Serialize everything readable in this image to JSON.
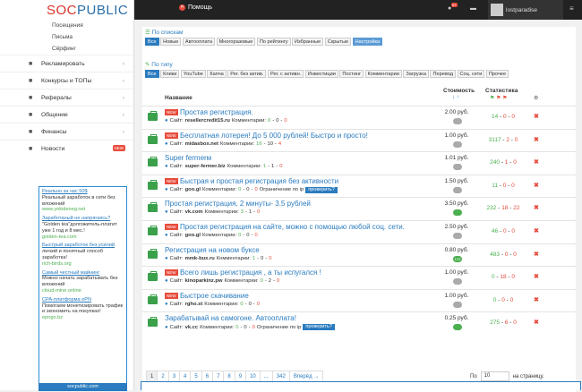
{
  "topbar": {
    "logo_a": "SOC",
    "logo_b": "PUBLIC",
    "help": "Помощь",
    "badge": "9+",
    "user": "lostparadise"
  },
  "sidebar": {
    "subitems": [
      "Посещения",
      "Письма",
      "Сёрфинг"
    ],
    "items": [
      {
        "label": "Рекламировать",
        "icon": "chart-icon"
      },
      {
        "label": "Конкурсы и ТОПы",
        "icon": "trophy-icon"
      },
      {
        "label": "Рефералы",
        "icon": "users-icon"
      },
      {
        "label": "Общение",
        "icon": "chat-icon"
      },
      {
        "label": "Финансы",
        "icon": "bank-icon"
      },
      {
        "label": "Новости",
        "icon": "news-icon",
        "badge": "NEW"
      }
    ],
    "ads": [
      {
        "title": "Реально за час 50$",
        "desc": "Реальный заработок в сети без вложений",
        "url": "www.yokideneg.net"
      },
      {
        "title": "Заработаный не напрягаясь?",
        "desc": "\"Golden tea\"долгожитель-платит уже 1 год и 8 мес.!",
        "url": "golden-tea.com"
      },
      {
        "title": "Быстрый заработок без усилий",
        "desc": "легкий и понятный способ заработка!",
        "url": "rich-birds.org"
      },
      {
        "title": "Самый честный майнинг",
        "desc": "Можно начать зарабатывать без вложений",
        "url": "cloud-mine.online"
      },
      {
        "title": "CPA-платформа ePN",
        "desc": "Помогаем монетизировать трафик и экономить на покупках!",
        "url": "epngo.bz"
      }
    ],
    "ads_footer": "socpublic.com"
  },
  "lists": {
    "title": "По спискам",
    "filters": [
      "Все",
      "Новые",
      "Автооплата",
      "Многоразовые",
      "По рейтингу",
      "Избранные",
      "Скрытые",
      "Настройка"
    ]
  },
  "types": {
    "title": "По типу",
    "filters": [
      "Все",
      "Клики",
      "YouTube",
      "Капча",
      "Рег. без актив.",
      "Рег. с активн.",
      "Инвестиции",
      "Постинг",
      "Комментарии",
      "Загрузка",
      "Перевод",
      "Соц. сети",
      "Прочее"
    ]
  },
  "table": {
    "h_name": "Название",
    "h_cost": "Стоимость",
    "h_stats": "Статистика",
    "site_label": "Сайт:",
    "comments_label": "Комментарии:",
    "limit_label": "Ограничение по ip",
    "check_label": "проверить?",
    "rows": [
      {
        "new": true,
        "title": "Простая регистрация.",
        "site": "resellercredit15.ru",
        "c": [
          "0",
          "0",
          "0"
        ],
        "cost": "2.00 руб.",
        "pill": "",
        "pillc": "#aaa",
        "st": [
          "14",
          "0",
          "0"
        ]
      },
      {
        "new": true,
        "title": "Бесплатная лотерея! До 5 000 рублей! Быстро и просто!",
        "site": "midasbox.net",
        "c": [
          "16",
          "10",
          "4"
        ],
        "cost": "1.00 руб.",
        "pill": "",
        "pillc": "#aaa",
        "st": [
          "3117",
          "2",
          "0"
        ]
      },
      {
        "new": false,
        "title": "Super fermerм",
        "site": "super-fermer.biz",
        "c": [
          "1",
          "1",
          "0"
        ],
        "cost": "1.01 руб.",
        "pill": "",
        "pillc": "#aaa",
        "st": [
          "240",
          "1",
          "0"
        ]
      },
      {
        "new": true,
        "title": "Быстрая и простая регистрация без активности",
        "site": "goo.gl",
        "c": [
          "0",
          "0",
          "0"
        ],
        "limit": true,
        "cost": "1.50 руб.",
        "pill": "",
        "pillc": "#aaa",
        "st": [
          "11",
          "0",
          "0"
        ]
      },
      {
        "new": false,
        "title": "Простая регистрация, 2 минуты- 3.5 рублей",
        "site": "vk.com",
        "c": [
          "3",
          "1",
          "0"
        ],
        "cost": "3.50 руб.",
        "pill": "",
        "pillc": "#4caf50",
        "st": [
          "232",
          "18",
          "22"
        ]
      },
      {
        "new": true,
        "title": "Простая регистрация на сайте, можно с помощью любой соц. сети.",
        "site": "goo.gl",
        "c": [
          "0",
          "0",
          "0"
        ],
        "cost": "2.50 руб.",
        "pill": "",
        "pillc": "#aaa",
        "st": [
          "46",
          "0",
          "0"
        ]
      },
      {
        "new": false,
        "title": "Регистрация на новом буксе",
        "site": "mmk-bux.ru",
        "c": [
          "1",
          "0",
          "0"
        ],
        "cost": "0.80 руб.",
        "pill": "123",
        "pillc": "#4caf50",
        "st": [
          "483",
          "0",
          "0"
        ]
      },
      {
        "new": true,
        "title": "Всего лишь регистрация , а ты испугался !",
        "site": "kinoparkinz.pw",
        "c": [
          "0",
          "2",
          "0"
        ],
        "cost": "1.00 руб.",
        "pill": "",
        "pillc": "#aaa",
        "st": [
          "0",
          "18",
          "0"
        ]
      },
      {
        "new": true,
        "title": "Быстрое скачивание",
        "site": "rgho.st",
        "c": [
          "0",
          "0",
          "0"
        ],
        "cost": "1.00 руб.",
        "pill": "",
        "pillc": "#aaa",
        "st": [
          "0",
          "0",
          "0"
        ]
      },
      {
        "new": false,
        "title": "Зарабатывай на самогоне. Автооплата!",
        "site": "vk.cc",
        "c": [
          "0",
          "0",
          "0"
        ],
        "limit": true,
        "cost": "0.25 руб.",
        "pill": "",
        "pillc": "#4caf50",
        "st": [
          "275",
          "6",
          "0"
        ]
      }
    ]
  },
  "pager": {
    "pages": [
      "1",
      "2",
      "3",
      "4",
      "5",
      "6",
      "7",
      "8",
      "9",
      "10",
      "...",
      "342",
      "Вперёд →"
    ],
    "per_label": "По",
    "per_value": "10",
    "per_suffix": "на страницу."
  },
  "colors": {
    "accent": "#2a7bbf",
    "green": "#4caf50",
    "red": "#e74c3c"
  }
}
